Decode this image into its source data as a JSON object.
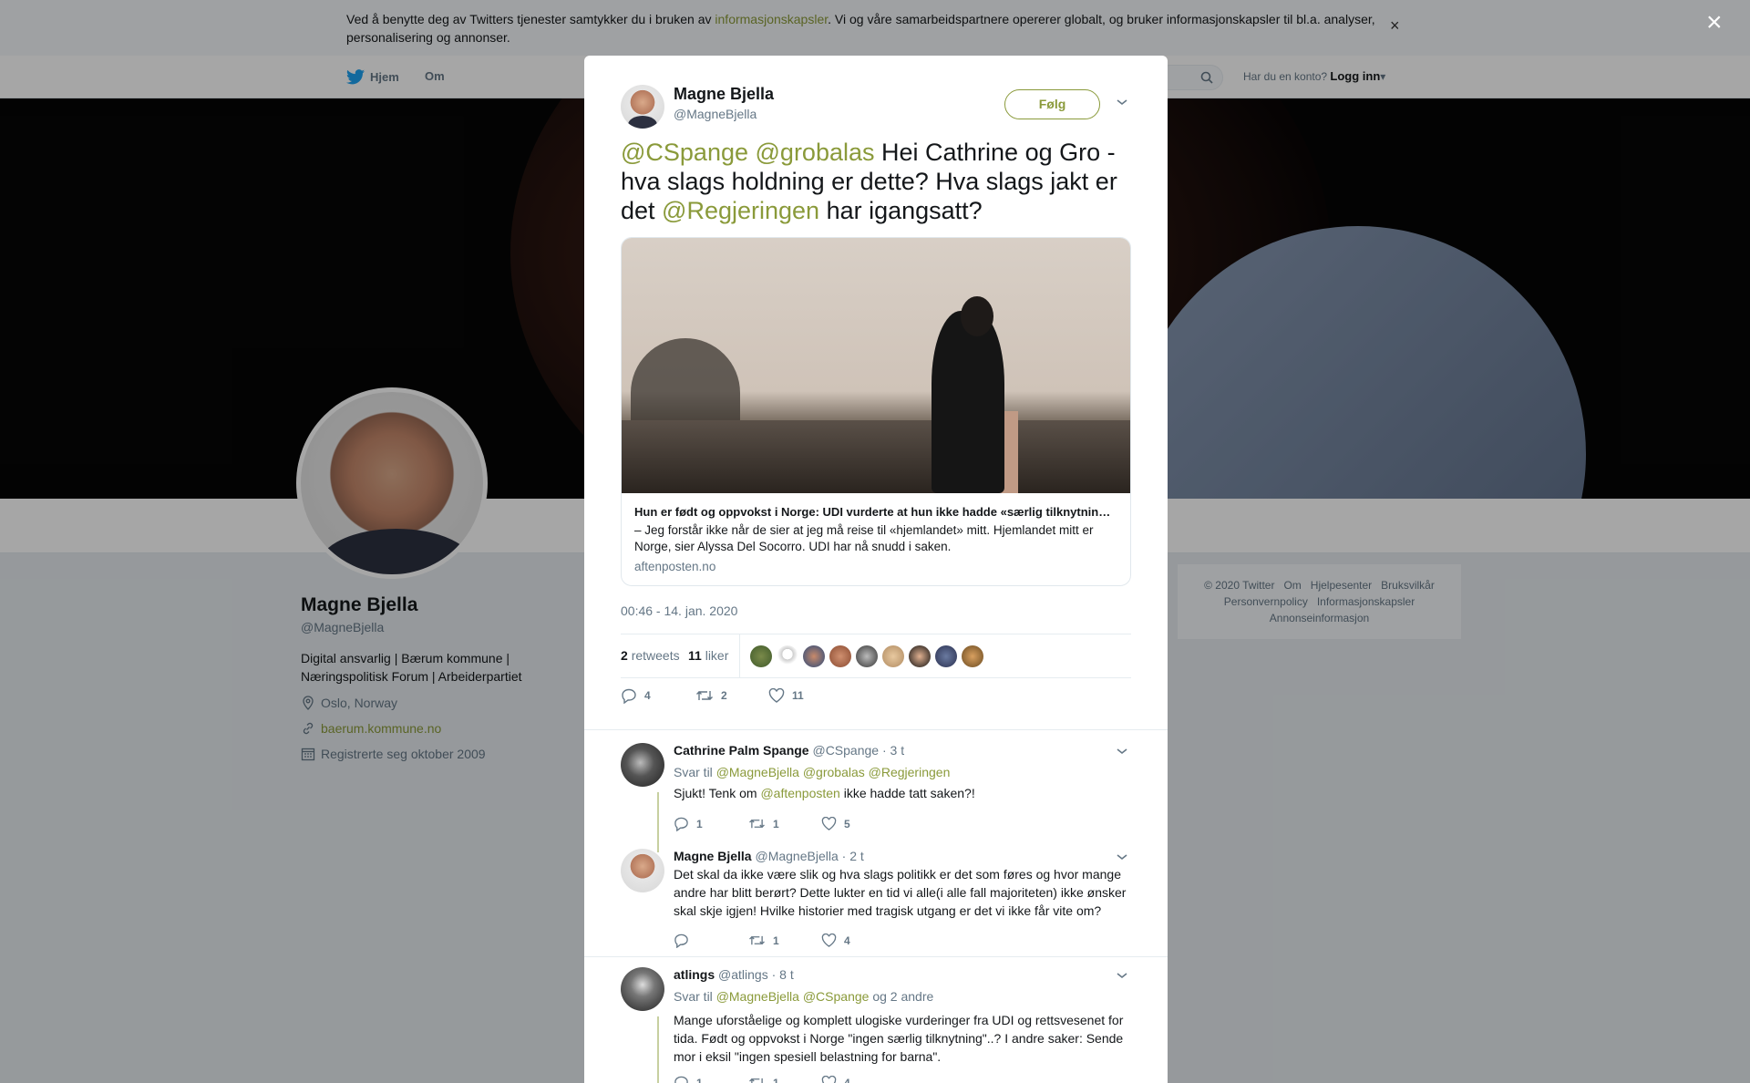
{
  "cookie": {
    "text_before": "Ved å benytte deg av Twitters tjenester samtykker du i bruken av ",
    "link": "informasjonskapsler",
    "text_after": ". Vi og våre samarbeidspartnere opererer globalt, og bruker informasjonskapsler til bl.a. analyser, personalisering og annonser.",
    "close": "×"
  },
  "nav": {
    "home": "Hjem",
    "about": "Om",
    "login_prompt": "Har du en konto?",
    "login": "Logg inn"
  },
  "profile": {
    "name": "Magne Bjella",
    "handle": "@MagneBjella",
    "bio": "Digital ansvarlig | Bærum kommune | Næringspolitisk Forum | Arbeiderpartiet",
    "location": "Oslo, Norway",
    "website": "baerum.kommune.no",
    "joined": "Registrerte seg oktober 2009"
  },
  "footer": {
    "links": [
      "© 2020 Twitter",
      "Om",
      "Hjelpesenter",
      "Bruksvilkår",
      "Personvernpolicy",
      "Informasjonskapsler",
      "Annonseinformasjon"
    ]
  },
  "overlay_close": "×",
  "tweet": {
    "name": "Magne Bjella",
    "handle": "@MagneBjella",
    "follow": "Følg",
    "text_parts": {
      "m1": "@CSpange",
      "m2": "@grobalas",
      "t1": " Hei Cathrine og Gro - hva slags holdning er dette? Hva slags jakt er det ",
      "m3": "@Regjeringen",
      "t2": " har igangsatt?"
    },
    "card": {
      "title": "Hun er født og oppvokst i Norge: UDI vurderte at hun ikke hadde «særlig tilknytning» til Norge",
      "description": "– Jeg forstår ikke når de sier at jeg må reise til «hjemlandet» mitt. Hjemlandet mitt er Norge, sier Alyssa Del Socorro. UDI har nå snudd i saken.",
      "domain": "aftenposten.no"
    },
    "timestamp": "00:46 - 14. jan. 2020",
    "retweets_count": "2",
    "retweets_label": "retweets",
    "likes_count": "11",
    "likes_label": "liker",
    "actions": {
      "reply": "4",
      "retweet": "2",
      "like": "11"
    }
  },
  "replies": [
    {
      "name": "Cathrine Palm Spange",
      "handle": "@CSpange",
      "time": "· 3 t",
      "reply_to_label": "Svar til",
      "reply_to": "@MagneBjella @grobalas @Regjeringen",
      "body_before": "Sjukt! Tenk om ",
      "body_mention": "@aftenposten",
      "body_after": " ikke hadde tatt saken?!",
      "actions": {
        "reply": "1",
        "retweet": "1",
        "like": "5"
      }
    },
    {
      "name": "Magne Bjella",
      "handle": "@MagneBjella",
      "time": "· 2 t",
      "body": "Det skal da ikke være slik og hva slags politikk er det som føres og hvor mange andre har blitt berørt? Dette lukter en tid vi alle(i alle fall majoriteten) ikke ønsker skal skje igjen! Hvilke historier med tragisk utgang er det vi ikke får vite om?",
      "actions": {
        "reply": "",
        "retweet": "1",
        "like": "4"
      }
    },
    {
      "name": "atlings",
      "handle": "@atlings",
      "time": "· 8 t",
      "reply_to_label": "Svar til",
      "reply_to": "@MagneBjella @CSpange",
      "reply_to_more": " og 2 andre",
      "body": "Mange uforståelige og komplett ulogiske vurderinger fra UDI og rettsvesenet for tida. Født og oppvokst i Norge \"ingen særlig tilknytning\"..? I andre saker: Sende mor i eksil \"ingen spesiell belastning for barna\".",
      "actions": {
        "reply": "1",
        "retweet": "1",
        "like": "4"
      }
    }
  ],
  "colors": {
    "accent": "#8a9a3a",
    "text": "#14171a",
    "muted": "#657786"
  }
}
